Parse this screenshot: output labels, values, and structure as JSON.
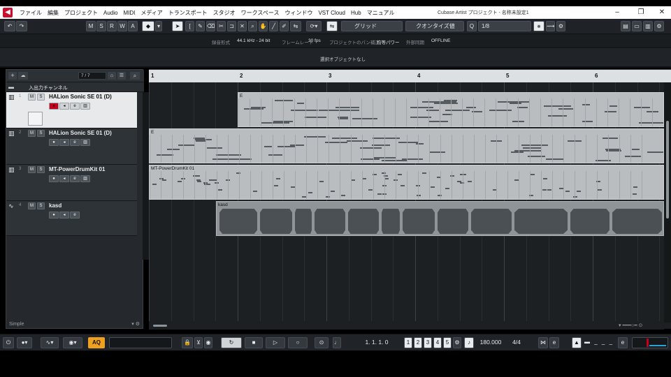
{
  "menubar": {
    "items": [
      "ファイル",
      "編集",
      "プロジェクト",
      "Audio",
      "MIDI",
      "メディア",
      "トランスポート",
      "スタジオ",
      "ワークスペース",
      "ウィンドウ",
      "VST Cloud",
      "Hub",
      "マニュアル"
    ],
    "window_title": "Cubase Artist プロジェクト - 名称未設定1"
  },
  "toolbar": {
    "undo": "↶",
    "redo": "↷",
    "msrwa": [
      "M",
      "S",
      "R",
      "W",
      "A"
    ],
    "snap_type": "グリッド",
    "quantize_type": "クオンタイズ値",
    "quantize_value": "1/8",
    "q_label": "Q"
  },
  "infoline": {
    "rate_label": "録音形式",
    "rate_value": "44.1 kHz - 24 bit",
    "frame_label": "フレームレート",
    "frame_value": "30 fps",
    "pan_label": "プロジェクトのパン補正",
    "pan_value": "均等パワー",
    "sync_label": "外部同期",
    "sync_value": "OFFLINE"
  },
  "selection_info": "選択オブジェクトなし",
  "track_panel": {
    "counter": "7 / 7",
    "folder_label": "入出力チャンネル",
    "tracks": [
      {
        "num": "1",
        "name": "HALion Sonic SE 01 (D)"
      },
      {
        "num": "2",
        "name": "HALion Sonic SE 01 (D)"
      },
      {
        "num": "3",
        "name": "MT-PowerDrumKit 01"
      },
      {
        "num": "4",
        "name": "kasd"
      }
    ],
    "footer": "Simple"
  },
  "ruler": {
    "bars": [
      "1",
      "2",
      "3",
      "4",
      "5",
      "6"
    ]
  },
  "parts": {
    "p1": "E",
    "p2": "E",
    "p3": "MT-PowerDrumKit 01",
    "p4": "kasd"
  },
  "transport": {
    "aq": "AQ",
    "position": "1. 1. 1.    0",
    "tempo": "180.000",
    "signature": "4/4",
    "markers": [
      "1",
      "2",
      "3",
      "4",
      "5"
    ]
  },
  "colors": {
    "record": "#c4001d",
    "accent_orange": "#f0a020",
    "selected_track": "#e7e9ea"
  }
}
